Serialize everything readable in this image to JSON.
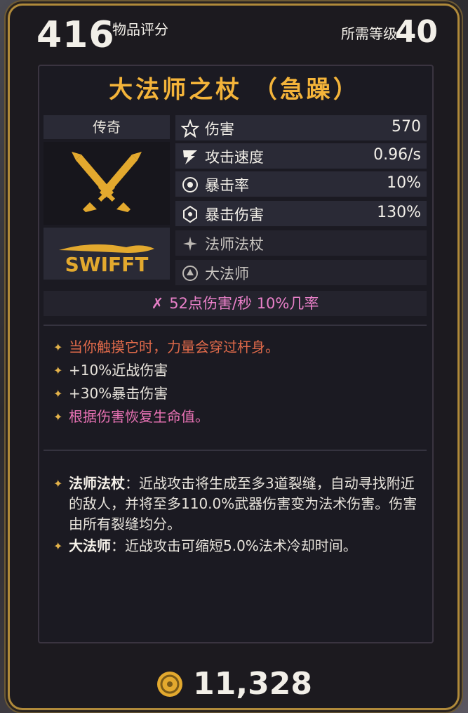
{
  "header": {
    "item_score": "416",
    "item_score_label": "物品评分",
    "level_label": "所需等级",
    "level_value": "40"
  },
  "item": {
    "name": "大法师之杖 （急躁）",
    "rarity": "传奇",
    "manufacturer": "SWIFFT"
  },
  "stats": [
    {
      "name": "伤害",
      "value": "570",
      "icon": "damage-icon"
    },
    {
      "name": "攻击速度",
      "value": "0.96/s",
      "icon": "attack-speed-icon"
    },
    {
      "name": "暴击率",
      "value": "10%",
      "icon": "crit-chance-icon"
    },
    {
      "name": "暴击伤害",
      "value": "130%",
      "icon": "crit-damage-icon"
    },
    {
      "name": "法师法杖",
      "value": "",
      "icon": "sparkle-icon"
    },
    {
      "name": "大法师",
      "value": "",
      "icon": "archmage-icon"
    }
  ],
  "dps_line": "52点伤害/秒  10%几率",
  "affixes": [
    {
      "text": "当你触摸它时，力量会穿过杆身。",
      "color": "#e06a4a"
    },
    {
      "text": "+10%近战伤害",
      "color": "#ece8e0"
    },
    {
      "text": "+30%暴击伤害",
      "color": "#ece8e0"
    },
    {
      "text": "根据伤害恢复生命值。",
      "color": "#e872b4"
    }
  ],
  "perks": [
    {
      "name": "法师法杖",
      "text": "：近战攻击将生成至多3道裂缝，自动寻找附近的敌人，并将至多110.0%武器伤害变为法术伤害。伤害由所有裂缝均分。"
    },
    {
      "name": "大法师",
      "text": "：近战攻击可缩短5.0%法术冷却时间。"
    }
  ],
  "cost": "11,328",
  "colors": {
    "title": "#f4b43a",
    "accent": "#e3b24a",
    "dps": "#e880c8"
  }
}
